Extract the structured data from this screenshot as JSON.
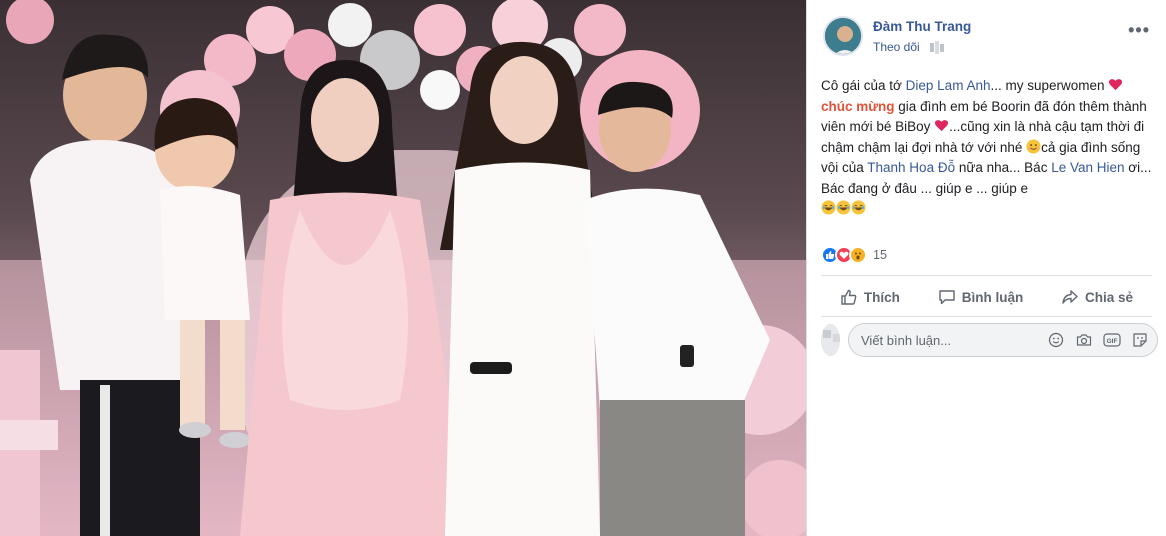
{
  "photo": {
    "alt": "Group photo"
  },
  "post": {
    "author": "Đàm Thu Trang",
    "follow_label": "Theo dõi",
    "line1": {
      "t1": "Cô gái của tớ ",
      "l1": "Diep Lam Anh",
      "t2": "... my superwomen "
    },
    "line2": {
      "h1": "chúc mừng",
      "t1": " gia đình em bé Boorin đã đón thêm thành viên mới bé BiBoy "
    },
    "line3": {
      "t1": "...cũng xin là nhà cậu tạm thời đi chậm chậm lại đợi nhà tớ với nhé "
    },
    "line4": {
      "t1": "cả gia đình sống vội của ",
      "l1": "Thanh Hoa Đỗ",
      "t2": " nữa nha... Bác ",
      "l2": "Le Van Hien",
      "t3": " ơi... Bác đang ở đâu ... giúp e ... giúp e "
    },
    "reaction_count": "15",
    "actions": {
      "like": "Thích",
      "comment": "Bình luận",
      "share": "Chia sẻ"
    },
    "comment_placeholder": "Viết bình luận..."
  },
  "colors": {
    "link": "#385898",
    "highlight": "#e0533a",
    "like": "#1877f2",
    "love": "#f33e58"
  }
}
